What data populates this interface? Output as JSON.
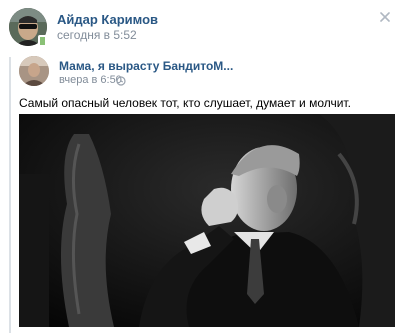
{
  "post": {
    "author": {
      "name": "Айдар Каримов",
      "time": "сегодня в 5:52",
      "online": true
    },
    "close_icon": "close-icon",
    "repost": {
      "source_name": "Мама, я вырасту БандитоМ...",
      "time": "вчера в 6:50",
      "source_icon": "clock-icon",
      "text": "Самый опасный человек тот, кто слушает, думает и молчит."
    },
    "photo": {
      "subject": "black-and-white photo of a thoughtful man in a suit"
    }
  },
  "colors": {
    "link": "#2a5885",
    "meta": "#818c99",
    "online": "#8ac176",
    "divider": "#dce1e6"
  }
}
